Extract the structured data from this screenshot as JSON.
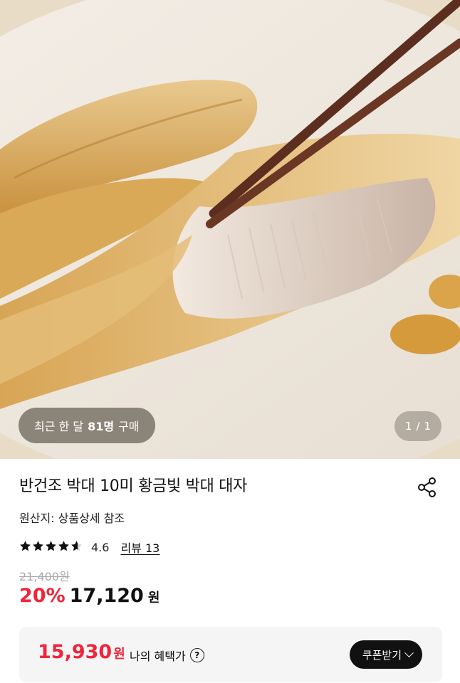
{
  "gallery": {
    "recent_purchase_prefix": "최근 한 달",
    "recent_purchase_count": "81명",
    "recent_purchase_suffix": "구매",
    "image_index": "1",
    "image_separator": "/",
    "image_total": "1"
  },
  "product": {
    "title": "반건조 박대 10미 황금빛 박대 대자",
    "origin": "원산지: 상품상세 참조",
    "rating": "4.6",
    "rating_stars": 4.6,
    "review_link": "리뷰 13",
    "original_price": "21,400원",
    "discount_rate": "20%",
    "sale_price": "17,120",
    "currency_unit": "원"
  },
  "benefit": {
    "price": "15,930",
    "currency_unit": "원",
    "label": "나의 혜택가",
    "help_icon": "?",
    "coupon_button": "쿠폰받기"
  },
  "colors": {
    "accent_red": "#f0253a",
    "button_dark": "#111111",
    "benefit_bg": "#f5f5f6"
  },
  "icons": [
    "share-icon",
    "star-icon",
    "help-icon",
    "chevron-down-icon"
  ]
}
